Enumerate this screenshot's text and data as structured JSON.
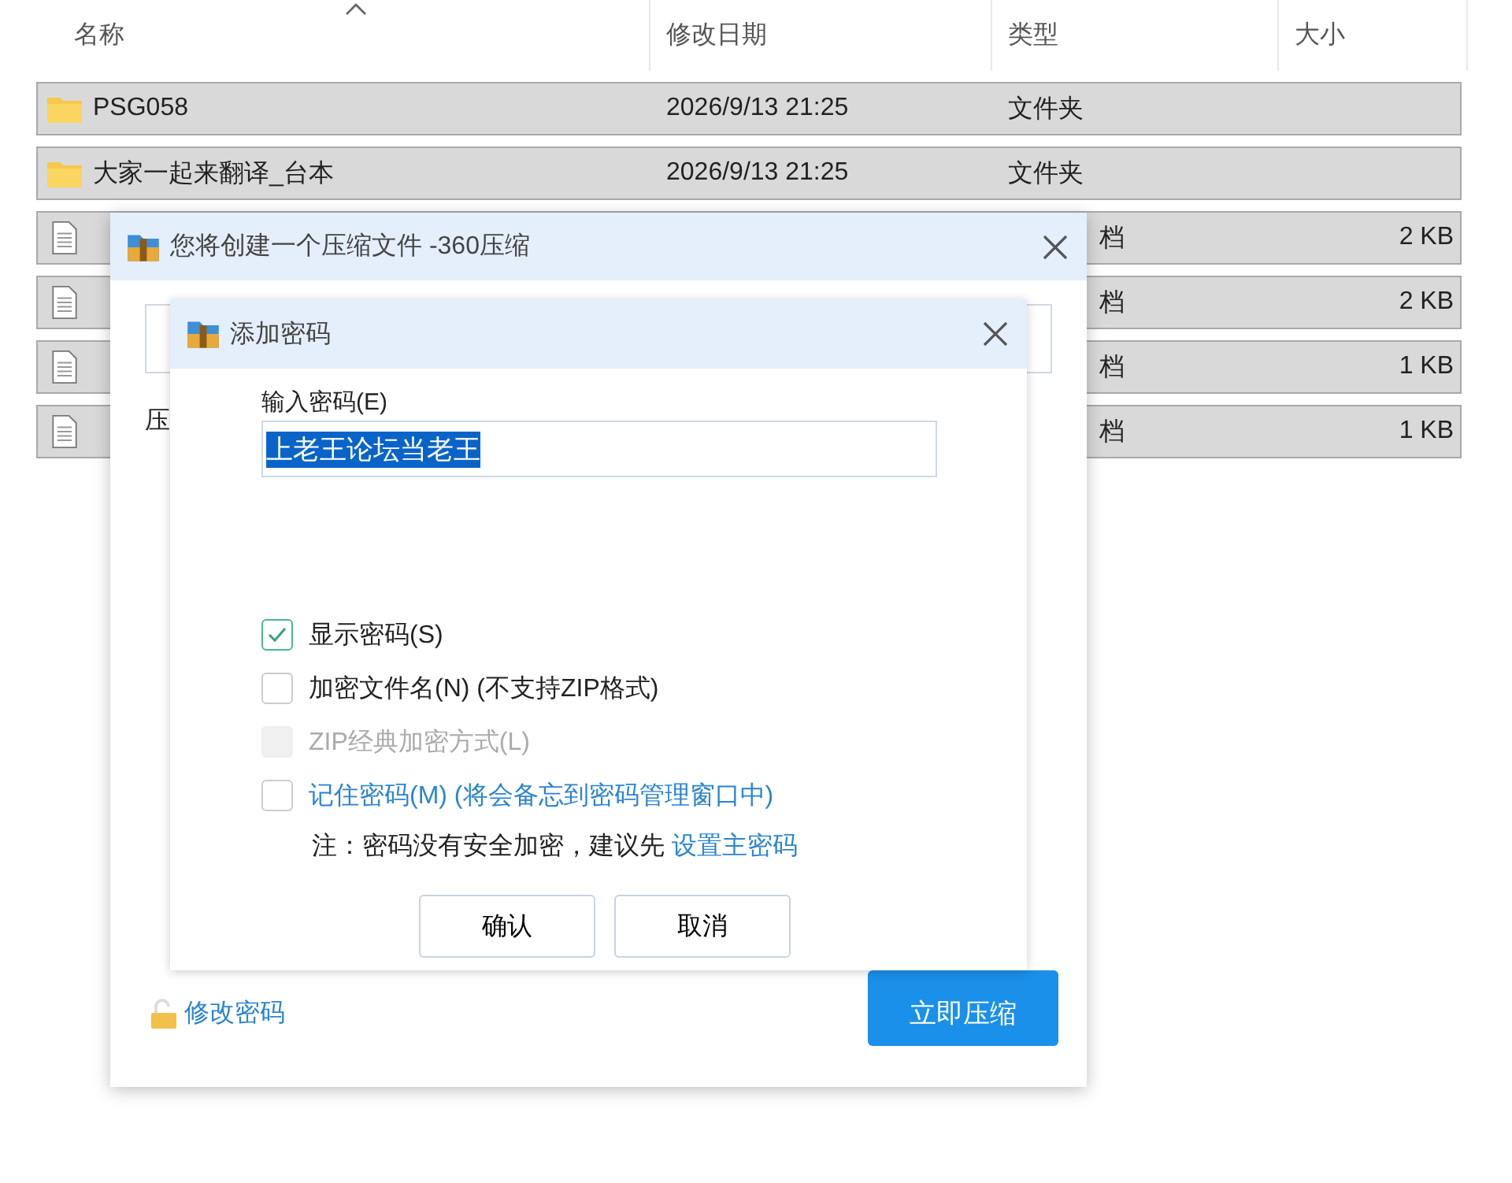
{
  "explorer": {
    "columns": [
      "名称",
      "修改日期",
      "类型",
      "大小"
    ],
    "rows": [
      {
        "kind": "folder",
        "name": "PSG058",
        "date": "2026/9/13 21:25",
        "type": "文件夹",
        "size": "",
        "selected": true
      },
      {
        "kind": "folder",
        "name": "大家一起来翻译_台本",
        "date": "2026/9/13 21:25",
        "type": "文件夹",
        "size": "",
        "selected": true
      },
      {
        "kind": "file",
        "name": "",
        "date": "",
        "type": "档",
        "size": "2 KB",
        "selected": true
      },
      {
        "kind": "file",
        "name": "",
        "date": "",
        "type": "档",
        "size": "2 KB",
        "selected": true
      },
      {
        "kind": "file",
        "name": "",
        "date": "",
        "type": "档",
        "size": "1 KB",
        "selected": true
      },
      {
        "kind": "file",
        "name": "",
        "date": "",
        "type": "档",
        "size": "1 KB",
        "selected": true
      }
    ]
  },
  "compress_dialog": {
    "title": "您将创建一个压缩文件 -360压缩",
    "label": "压",
    "change_password_link": "修改密码",
    "compress_button": "立即压缩"
  },
  "password_dialog": {
    "title": "添加密码",
    "input_label": "输入密码(E)",
    "password": {
      "value": "上老王论坛当老王",
      "selected": true
    },
    "options": [
      {
        "label": "显示密码(S)",
        "checked": true,
        "disabled": false,
        "link": false
      },
      {
        "label": "加密文件名(N) (不支持ZIP格式)",
        "checked": false,
        "disabled": false,
        "link": false
      },
      {
        "label": "ZIP经典加密方式(L)",
        "checked": false,
        "disabled": true,
        "link": false
      },
      {
        "label": "记住密码(M) (将会备忘到密码管理窗口中)",
        "checked": false,
        "disabled": false,
        "link": true
      }
    ],
    "note": "注：密码没有安全加密，建议先",
    "note_link": "设置主密码",
    "buttons": [
      "确认",
      "取消"
    ]
  }
}
